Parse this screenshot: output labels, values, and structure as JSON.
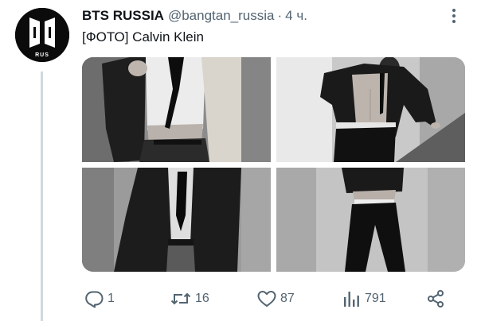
{
  "tweet": {
    "avatar": {
      "logo_text": "RUS",
      "bg_color": "#0b0b0b"
    },
    "author": {
      "name": "BTS RUSSIA",
      "handle": "@bangtan_russia",
      "separator": "·",
      "time": "4 ч."
    },
    "text": "[ФОТО] Calvin Klein",
    "media": {
      "photos": [
        {
          "name": "photo-1",
          "alt": ""
        },
        {
          "name": "photo-2",
          "alt": ""
        },
        {
          "name": "photo-3",
          "alt": ""
        },
        {
          "name": "photo-4",
          "alt": ""
        }
      ]
    },
    "actions": {
      "reply": {
        "icon": "reply-icon",
        "count": "1"
      },
      "retweet": {
        "icon": "retweet-icon",
        "count": "16"
      },
      "like": {
        "icon": "heart-icon",
        "count": "87"
      },
      "views": {
        "icon": "views-icon",
        "count": "791"
      },
      "share": {
        "icon": "share-icon"
      }
    }
  },
  "colors": {
    "text_primary": "#0f1419",
    "text_secondary": "#536471",
    "thread_line": "#cfd9de",
    "background": "#ffffff"
  }
}
